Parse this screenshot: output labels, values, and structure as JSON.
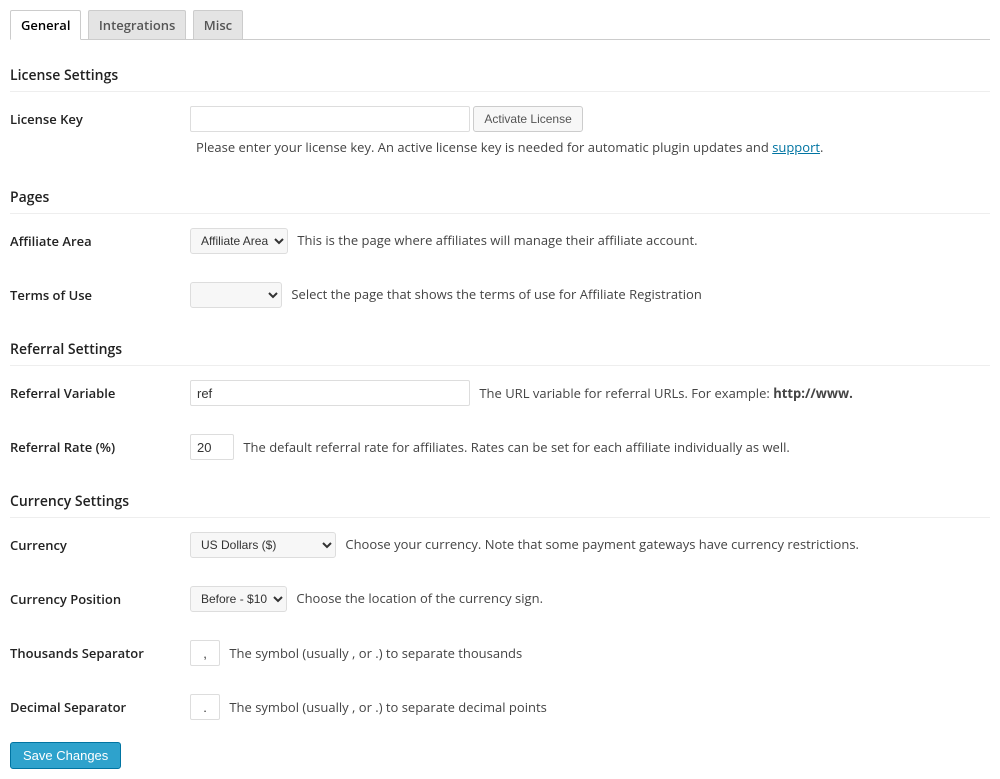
{
  "tabs": {
    "general": "General",
    "integrations": "Integrations",
    "misc": "Misc"
  },
  "sections": {
    "license": "License Settings",
    "pages": "Pages",
    "referral": "Referral Settings",
    "currency": "Currency Settings"
  },
  "fields": {
    "license_key": {
      "label": "License Key",
      "value": "",
      "button": "Activate License",
      "desc_prefix": "Please enter your license key. An active license key is needed for automatic plugin updates and ",
      "support_link": "support",
      "desc_suffix": "."
    },
    "affiliate_area": {
      "label": "Affiliate Area",
      "selected": "Affiliate Area",
      "desc": "This is the page where affiliates will manage their affiliate account."
    },
    "terms": {
      "label": "Terms of Use",
      "selected": "",
      "desc": "Select the page that shows the terms of use for Affiliate Registration"
    },
    "referral_variable": {
      "label": "Referral Variable",
      "value": "ref",
      "desc_prefix": "The URL variable for referral URLs. For example: ",
      "desc_strong": "http://www."
    },
    "referral_rate": {
      "label": "Referral Rate (%)",
      "value": "20",
      "desc": "The default referral rate for affiliates. Rates can be set for each affiliate individually as well."
    },
    "currency": {
      "label": "Currency",
      "selected": "US Dollars ($)",
      "desc": "Choose your currency. Note that some payment gateways have currency restrictions."
    },
    "currency_position": {
      "label": "Currency Position",
      "selected": "Before - $10",
      "desc": "Choose the location of the currency sign."
    },
    "thousands_sep": {
      "label": "Thousands Separator",
      "value": ",",
      "desc": "The symbol (usually , or .) to separate thousands"
    },
    "decimal_sep": {
      "label": "Decimal Separator",
      "value": ".",
      "desc": "The symbol (usually , or .) to separate decimal points"
    }
  },
  "buttons": {
    "save": "Save Changes"
  }
}
